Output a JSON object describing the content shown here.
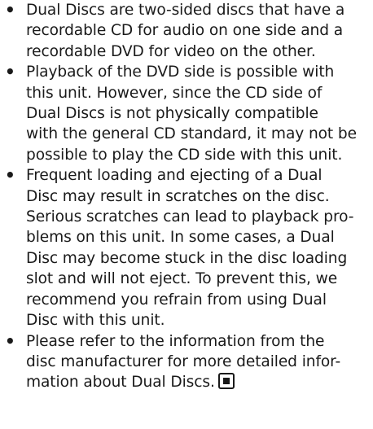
{
  "bullet_char": "•",
  "items": [
    {
      "lines": [
        "Dual Discs are two-sided discs that have a",
        "recordable CD for audio on one side and a",
        "recordable DVD for video on the other."
      ]
    },
    {
      "lines": [
        "Playback of the DVD side is possible with",
        "this unit. However, since the CD side of",
        "Dual Discs is not physically compatible",
        "with the general CD standard, it may not be",
        "possible to play the CD side with this unit."
      ]
    },
    {
      "lines": [
        "Frequent loading and ejecting of a Dual",
        "Disc may result in scratches on the disc.",
        "Serious scratches can lead to playback pro-",
        "blems on this unit. In some cases, a Dual",
        "Disc may become stuck in the disc loading",
        "slot and will not eject. To prevent this, we",
        "recommend you refrain from using Dual",
        "Disc with this unit."
      ]
    },
    {
      "lines": [
        "Please refer to the information from the",
        "disc manufacturer for more detailed infor-",
        "mation about Dual Discs."
      ],
      "end_icon": "stop-square-icon"
    }
  ]
}
